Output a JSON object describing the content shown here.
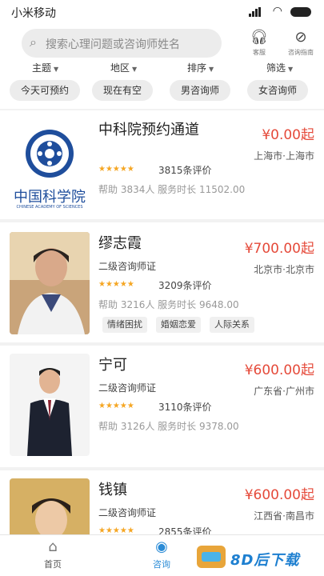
{
  "status": {
    "carrier": "小米移动"
  },
  "search": {
    "placeholder": "搜索心理问题或咨询师姓名"
  },
  "header_buttons": [
    {
      "label": "客服",
      "icon": "headset-icon"
    },
    {
      "label": "咨询指南",
      "icon": "compass-icon"
    }
  ],
  "filters": [
    "主题",
    "地区",
    "排序",
    "筛选"
  ],
  "chips": [
    "今天可预约",
    "现在有空",
    "男咨询师",
    "女咨询师"
  ],
  "cards": [
    {
      "name": "中科院预约通道",
      "price": "¥0.00起",
      "location": "上海市·上海市",
      "cert": "",
      "stars": "★★★★★",
      "reviews": "3815条评价",
      "help": "帮助 3834人 服务时长 11502.00",
      "tags": [],
      "logo_text": "中国科学院",
      "logo_sub": "CHINESE ACADEMY OF SCIENCES"
    },
    {
      "name": "缪志霞",
      "price": "¥700.00起",
      "location": "北京市·北京市",
      "cert": "二级咨询师证",
      "stars": "★★★★★",
      "reviews": "3209条评价",
      "help": "帮助 3216人 服务时长 9648.00",
      "tags": [
        "情绪困扰",
        "婚姻恋爱",
        "人际关系"
      ]
    },
    {
      "name": "宁可",
      "price": "¥600.00起",
      "location": "广东省·广州市",
      "cert": "二级咨询师证",
      "stars": "★★★★★",
      "reviews": "3110条评价",
      "help": "帮助 3126人 服务时长 9378.00",
      "tags": []
    },
    {
      "name": "钱镇",
      "price": "¥600.00起",
      "location": "江西省·南昌市",
      "cert": "二级咨询师证",
      "stars": "★★★★★",
      "reviews": "2855条评价",
      "help": "",
      "tags": []
    }
  ],
  "tabs": [
    {
      "label": "首页",
      "icon": "home-icon"
    },
    {
      "label": "咨询",
      "icon": "chat-icon"
    }
  ],
  "watermark": {
    "text": "8D后下载"
  },
  "colors": {
    "price": "#e54a3a",
    "accent": "#2a8bd6",
    "stars": "#f5a623"
  }
}
